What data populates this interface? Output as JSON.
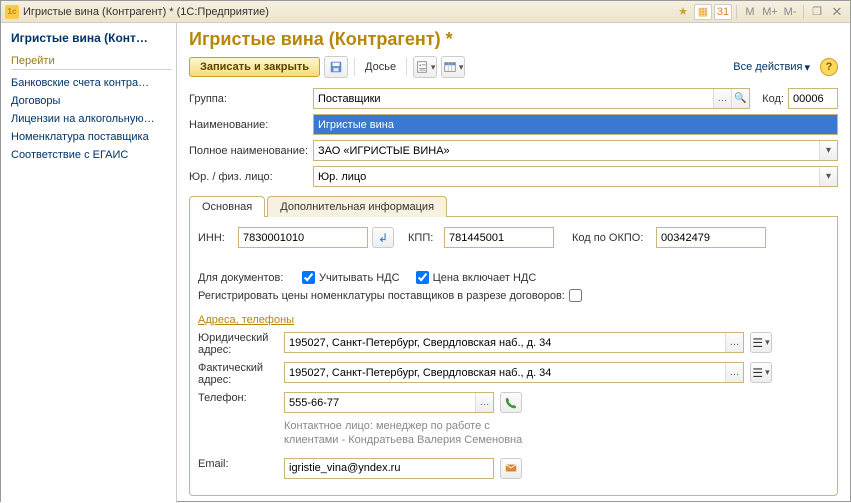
{
  "window": {
    "title": "Игристые вина (Контрагент) * (1С:Предприятие)",
    "buttons": {
      "m": "M",
      "mplus": "M+",
      "mminus": "M-"
    }
  },
  "sidebar": {
    "title": "Игристые вина (Конт…",
    "section": "Перейти",
    "links": [
      "Банковские счета контра…",
      "Договоры",
      "Лицензии на алкогольную…",
      "Номенклатура поставщика",
      "Соответствие с ЕГАИС"
    ]
  },
  "page": {
    "title": "Игристые вина (Контрагент) *"
  },
  "toolbar": {
    "save_close": "Записать и закрыть",
    "dossier": "Досье",
    "all_actions": "Все действия"
  },
  "form": {
    "group_label": "Группа:",
    "group_value": "Поставщики",
    "code_label": "Код:",
    "code_value": "00006",
    "name_label": "Наименование:",
    "name_value": "Игристые вина",
    "fullname_label": "Полное наименование:",
    "fullname_value": "ЗАО «ИГРИСТЫЕ ВИНА»",
    "jurfiz_label": "Юр. / физ. лицо:",
    "jurfiz_value": "Юр. лицо"
  },
  "tabs": {
    "main": "Основная",
    "additional": "Дополнительная информация"
  },
  "main_tab": {
    "inn_label": "ИНН:",
    "inn_value": "7830001010",
    "kpp_label": "КПП:",
    "kpp_value": "781445001",
    "okpo_label": "Код по ОКПО:",
    "okpo_value": "00342479",
    "docs_label": "Для документов:",
    "vat_account": "Учитывать НДС",
    "vat_include": "Цена включает НДС",
    "register_prices": "Регистрировать цены номенклатуры поставщиков в разрезе договоров:",
    "section_addr": "Адреса, телефоны",
    "legal_addr_label": "Юридический адрес:",
    "legal_addr_value": "195027, Санкт-Петербург, Свердловская наб., д. 34",
    "actual_addr_label": "Фактический адрес:",
    "actual_addr_value": "195027, Санкт-Петербург, Свердловская наб., д. 34",
    "phone_label": "Телефон:",
    "phone_value": "555-66-77",
    "contact_hint": "Контактное лицо: менеджер по работе с клиентами - Кондратьева Валерия Семеновна",
    "email_label": "Email:",
    "email_value": "igristie_vina@yndex.ru"
  }
}
